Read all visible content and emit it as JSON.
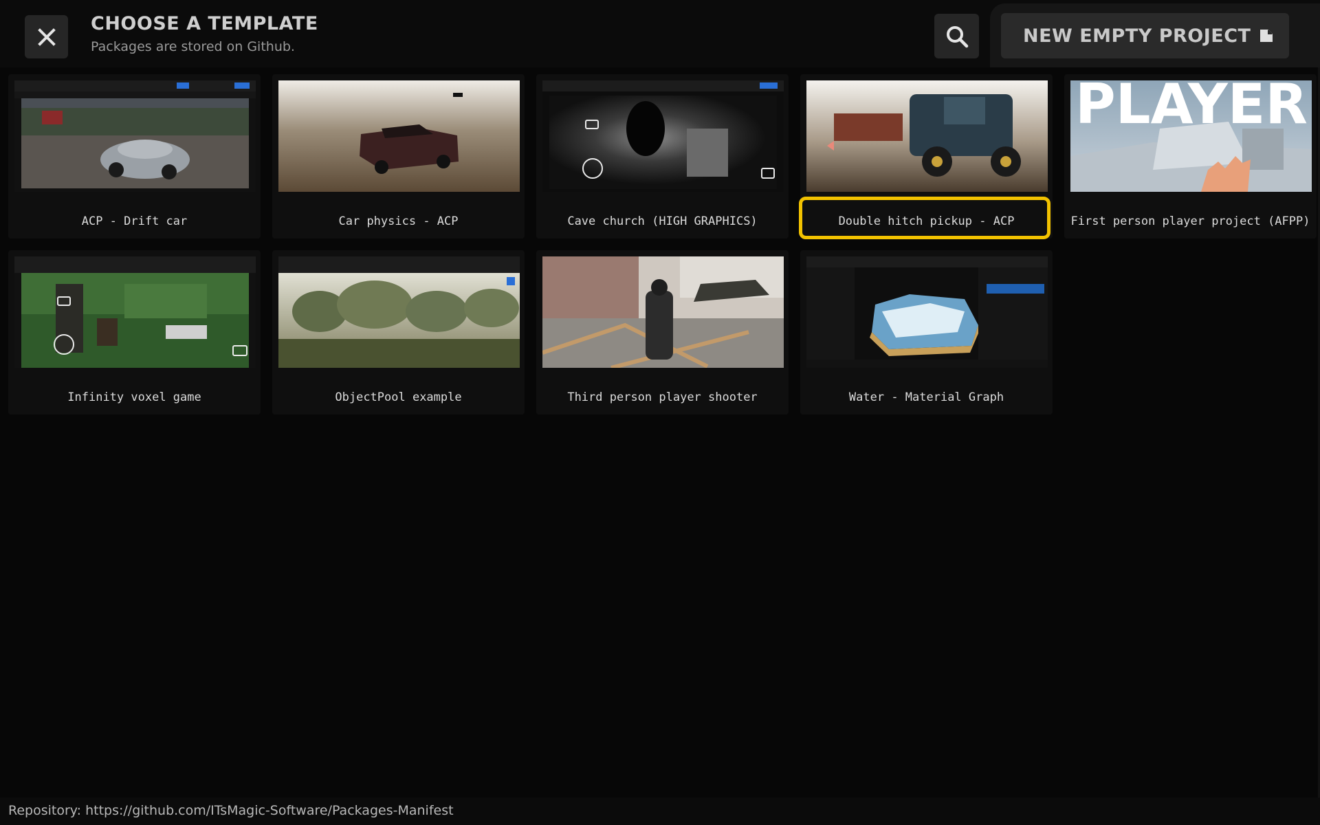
{
  "header": {
    "title": "CHOOSE A TEMPLATE",
    "subtitle": "Packages are stored on Github.",
    "close_icon": "close-icon",
    "search_icon": "search-icon",
    "new_project_label": "NEW EMPTY PROJECT",
    "new_project_icon": "file-icon"
  },
  "templates": [
    {
      "label": "ACP - Drift car",
      "selected": false
    },
    {
      "label": "Car physics - ACP",
      "selected": false
    },
    {
      "label": "Cave church (HIGH GRAPHICS)",
      "selected": false
    },
    {
      "label": "Double hitch pickup - ACP",
      "selected": true
    },
    {
      "label": "First person player project (AFPP)",
      "selected": false
    },
    {
      "label": "Infinity voxel game",
      "selected": false
    },
    {
      "label": "ObjectPool example",
      "selected": false
    },
    {
      "label": "Third person player shooter",
      "selected": false
    },
    {
      "label": "Water - Material Graph",
      "selected": false
    }
  ],
  "thumbnail_texts": {
    "afpp_banner": "PLAYER"
  },
  "footer": {
    "repository_text": "Repository: https://github.com/ITsMagic-Software/Packages-Manifest"
  },
  "colors": {
    "selection_ring": "#f2c200",
    "background": "#070707",
    "button_bg": "#262626"
  }
}
